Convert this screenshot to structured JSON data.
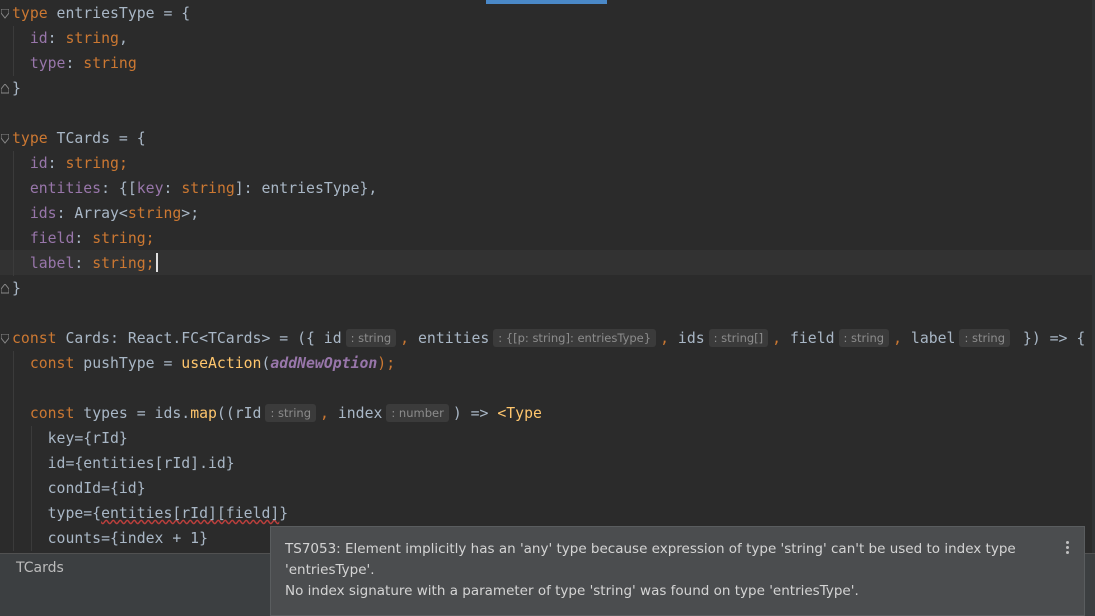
{
  "editor": {
    "lines": [
      {
        "tokens": [
          {
            "t": "type",
            "c": "kw"
          },
          {
            "t": " entriesType = {"
          }
        ]
      },
      {
        "tokens": [
          {
            "t": "  "
          },
          {
            "t": "id",
            "c": "prop"
          },
          {
            "t": ": "
          },
          {
            "t": "string",
            "c": "type"
          },
          {
            "t": ","
          }
        ]
      },
      {
        "tokens": [
          {
            "t": "  "
          },
          {
            "t": "type",
            "c": "prop"
          },
          {
            "t": ": "
          },
          {
            "t": "string",
            "c": "type"
          }
        ]
      },
      {
        "tokens": [
          {
            "t": "}"
          }
        ]
      },
      {
        "tokens": []
      },
      {
        "tokens": [
          {
            "t": "type",
            "c": "kw"
          },
          {
            "t": " TCards = {"
          }
        ]
      },
      {
        "tokens": [
          {
            "t": "  "
          },
          {
            "t": "id",
            "c": "prop"
          },
          {
            "t": ": "
          },
          {
            "t": "string",
            "c": "type"
          },
          {
            "t": ";",
            "c": "kw"
          }
        ]
      },
      {
        "tokens": [
          {
            "t": "  "
          },
          {
            "t": "entities",
            "c": "prop"
          },
          {
            "t": ": {["
          },
          {
            "t": "key",
            "c": "prop"
          },
          {
            "t": ": "
          },
          {
            "t": "string",
            "c": "type"
          },
          {
            "t": "]: entriesType},"
          }
        ]
      },
      {
        "tokens": [
          {
            "t": "  "
          },
          {
            "t": "ids",
            "c": "prop"
          },
          {
            "t": ": Array<"
          },
          {
            "t": "string",
            "c": "type"
          },
          {
            "t": ">;"
          }
        ]
      },
      {
        "tokens": [
          {
            "t": "  "
          },
          {
            "t": "field",
            "c": "prop"
          },
          {
            "t": ": "
          },
          {
            "t": "string",
            "c": "type"
          },
          {
            "t": ";",
            "c": "kw"
          }
        ]
      },
      {
        "tokens": [
          {
            "t": "  "
          },
          {
            "t": "label",
            "c": "prop"
          },
          {
            "t": ": "
          },
          {
            "t": "string",
            "c": "type"
          },
          {
            "t": ";",
            "c": "kw"
          },
          {
            "caret": true
          }
        ]
      },
      {
        "tokens": [
          {
            "t": "}"
          }
        ]
      },
      {
        "tokens": []
      },
      {
        "tokens": [
          {
            "t": "const",
            "c": "kw"
          },
          {
            "t": " Cards: React.FC<TCards> = ({ id"
          },
          {
            "hint": ": string"
          },
          {
            "t": ", ",
            "c": "kw"
          },
          {
            "t": "entities"
          },
          {
            "hint": ": {[p: string]: entriesType}"
          },
          {
            "t": ", ",
            "c": "kw"
          },
          {
            "t": "ids"
          },
          {
            "hint": ": string[]"
          },
          {
            "t": ", ",
            "c": "kw"
          },
          {
            "t": "field"
          },
          {
            "hint": ": string"
          },
          {
            "t": ", ",
            "c": "kw"
          },
          {
            "t": "label"
          },
          {
            "hint": ": string"
          },
          {
            "t": " }) => {"
          }
        ]
      },
      {
        "tokens": [
          {
            "t": "  "
          },
          {
            "t": "const",
            "c": "kw"
          },
          {
            "t": " pushType = "
          },
          {
            "t": "useAction",
            "c": "fn"
          },
          {
            "t": "("
          },
          {
            "t": "addNewOption",
            "c": "it"
          },
          {
            "t": ");",
            "c": "kw"
          }
        ]
      },
      {
        "tokens": []
      },
      {
        "tokens": [
          {
            "t": "  "
          },
          {
            "t": "const",
            "c": "kw"
          },
          {
            "t": " types = ids."
          },
          {
            "t": "map",
            "c": "fn"
          },
          {
            "t": "((rId"
          },
          {
            "hint": ": string"
          },
          {
            "t": ", ",
            "c": "kw"
          },
          {
            "t": "index"
          },
          {
            "hint": ": number"
          },
          {
            "t": ") => "
          },
          {
            "t": "<Type",
            "c": "fn"
          }
        ]
      },
      {
        "tokens": [
          {
            "t": "    key={rId}"
          }
        ]
      },
      {
        "tokens": [
          {
            "t": "    id={entities[rId].id}"
          }
        ]
      },
      {
        "tokens": [
          {
            "t": "    condId={id}"
          }
        ]
      },
      {
        "tokens": [
          {
            "t": "    type={"
          },
          {
            "t": "entities[rId][field]",
            "c": "err"
          },
          {
            "t": "}"
          }
        ]
      },
      {
        "tokens": [
          {
            "t": "    counts={index + 1}"
          }
        ]
      }
    ]
  },
  "breadcrumb": {
    "label": "TCards"
  },
  "tooltip": {
    "line1": "TS7053: Element implicitly has an 'any' type because expression of type 'string' can't be used to index type",
    "line2": "'entriesType'.",
    "line3": "  No index signature with a parameter of type 'string' was found on type 'entriesType'."
  },
  "colors": {
    "background": "#2b2b2b",
    "keyword": "#cc7832",
    "property": "#9876aa",
    "function": "#ffc66d",
    "text": "#a9b7c6",
    "error_underline": "#bc3f3c",
    "tooltip_bg": "#4b4d4f",
    "tab_accent": "#4a88c7"
  },
  "icons": {
    "fold": "fold-arrow-icon",
    "more": "more-vertical-icon"
  }
}
